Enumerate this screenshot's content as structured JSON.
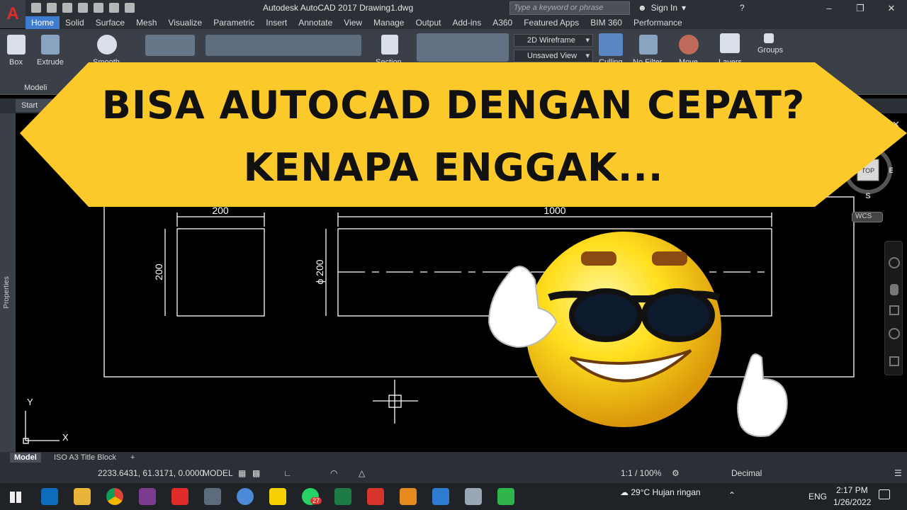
{
  "titlebar": {
    "window_title": "Autodesk AutoCAD 2017    Drawing1.dwg",
    "search_placeholder": "Type a keyword or phrase",
    "sign_in": "Sign In",
    "logo_letter": "A"
  },
  "ribbon_tabs": [
    "Home",
    "Solid",
    "Surface",
    "Mesh",
    "Visualize",
    "Parametric",
    "Insert",
    "Annotate",
    "View",
    "Manage",
    "Output",
    "Add-ins",
    "A360",
    "Featured Apps",
    "BIM 360",
    "Performance"
  ],
  "ribbon": {
    "box_label": "Box",
    "extrude_label": "Extrude",
    "smooth_label": "Smooth",
    "section_label": "Section",
    "culling_label": "Culling",
    "nofilter_label": "No Filter",
    "move_label": "Move",
    "layers_label": "Layers",
    "groups_label": "Groups",
    "visual_style": "2D Wireframe",
    "view_state": "Unsaved View",
    "panel_label": "Modeli"
  },
  "file_tab": "Start",
  "properties_label": "Properties",
  "banner": {
    "line1": "BISA AUTOCAD DENGAN CEPAT?",
    "line2": "KENAPA ENGGAK..."
  },
  "drawing": {
    "dim_rect_width": "200",
    "dim_rect_height": "200",
    "dim_shaft_length": "1000",
    "dim_shaft_diameter": "ϕ 200",
    "axis_y": "Y",
    "axis_x": "X"
  },
  "viewcube": {
    "top": "TOP",
    "east": "E",
    "south": "S",
    "wcs": "WCS"
  },
  "layout_tabs": {
    "model": "Model",
    "layout": "ISO A3 Title Block",
    "add": "+"
  },
  "statusbar": {
    "coordinates": "2233.6431, 61.3171, 0.0000",
    "model": "MODEL",
    "scale": "1:1 / 100%",
    "units": "Decimal"
  },
  "taskbar": {
    "weather": "29°C  Hujan ringan",
    "lang": "ENG",
    "time": "2:17 PM",
    "date": "1/26/2022",
    "whatsapp_badge": "27"
  },
  "colors": {
    "accent": "#3f7ccf",
    "banner": "#fcc92a",
    "autocad_red": "#e12b2b"
  }
}
